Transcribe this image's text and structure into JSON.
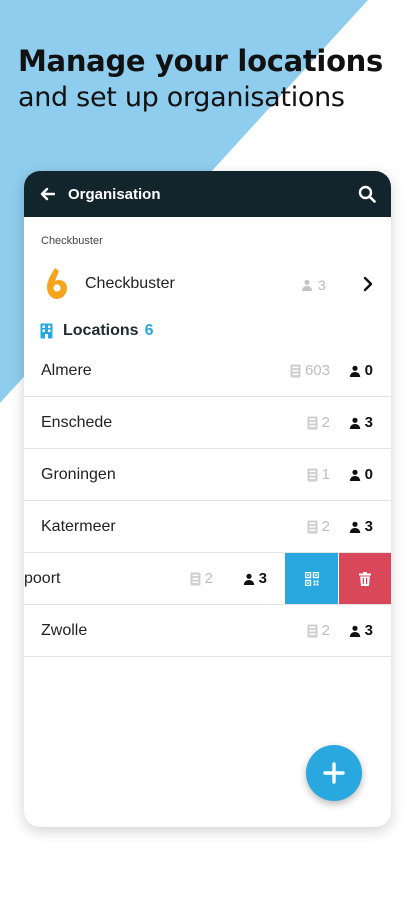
{
  "headline": {
    "line1": "Manage your locations",
    "line2": "and set up organisations"
  },
  "appbar": {
    "title": "Organisation",
    "back_icon": "arrow-left-icon",
    "search_icon": "search-icon"
  },
  "organisation": {
    "caption": "Checkbuster",
    "name": "Checkbuster",
    "members": "3",
    "logo_icon": "checkbuster-logo"
  },
  "locations": {
    "label": "Locations",
    "count": "6",
    "rows": [
      {
        "name": "Almere",
        "devices": "603",
        "members": "0"
      },
      {
        "name": "Enschede",
        "devices": "2",
        "members": "3"
      },
      {
        "name": "Groningen",
        "devices": "1",
        "members": "0"
      },
      {
        "name": "Katermeer",
        "devices": "2",
        "members": "3"
      },
      {
        "name": "poort",
        "devices": "2",
        "members": "3"
      },
      {
        "name": "Zwolle",
        "devices": "2",
        "members": "3"
      }
    ]
  },
  "colors": {
    "appbar": "#13252c",
    "accent": "#29a8e0",
    "delete": "#d9475a",
    "background_shape": "#8fcdee"
  },
  "icons": {
    "qr": "qr-code-icon",
    "delete": "trash-icon",
    "add": "plus-icon",
    "device": "device-icon",
    "member": "person-icon"
  }
}
